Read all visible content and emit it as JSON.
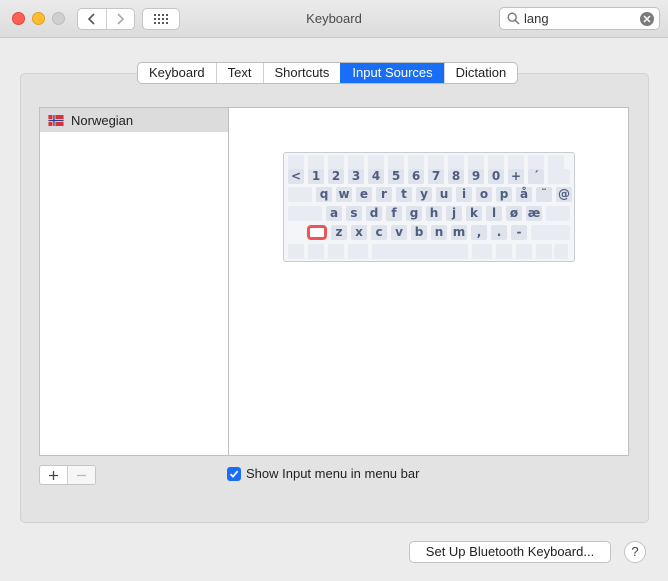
{
  "window": {
    "title": "Keyboard"
  },
  "search": {
    "value": "lang"
  },
  "tabs": [
    {
      "label": "Keyboard",
      "active": false
    },
    {
      "label": "Text",
      "active": false
    },
    {
      "label": "Shortcuts",
      "active": false
    },
    {
      "label": "Input Sources",
      "active": true
    },
    {
      "label": "Dictation",
      "active": false
    }
  ],
  "sources": [
    {
      "label": "Norwegian",
      "selected": true
    }
  ],
  "keyboard_rows": [
    [
      "<",
      "1",
      "2",
      "3",
      "4",
      "5",
      "6",
      "7",
      "8",
      "9",
      "0",
      "+",
      "´"
    ],
    [
      "q",
      "w",
      "e",
      "r",
      "t",
      "y",
      "u",
      "i",
      "o",
      "p",
      "å",
      "¨",
      "@"
    ],
    [
      "a",
      "s",
      "d",
      "f",
      "g",
      "h",
      "j",
      "k",
      "l",
      "ø",
      "æ"
    ],
    [
      "z",
      "x",
      "c",
      "v",
      "b",
      "n",
      "m",
      ",",
      ".",
      "-"
    ]
  ],
  "checkbox": {
    "label": "Show Input menu in menu bar",
    "checked": true
  },
  "buttons": {
    "bluetooth": "Set Up Bluetooth Keyboard...",
    "help": "?",
    "add": "+",
    "remove": "−"
  },
  "colors": {
    "accent": "#1a6ef5",
    "highlight": "#f0545b"
  },
  "icons": [
    "back-chevron-icon",
    "forward-chevron-icon",
    "grid-icon",
    "search-icon",
    "clear-icon",
    "norway-flag-icon",
    "checkmark-icon"
  ]
}
